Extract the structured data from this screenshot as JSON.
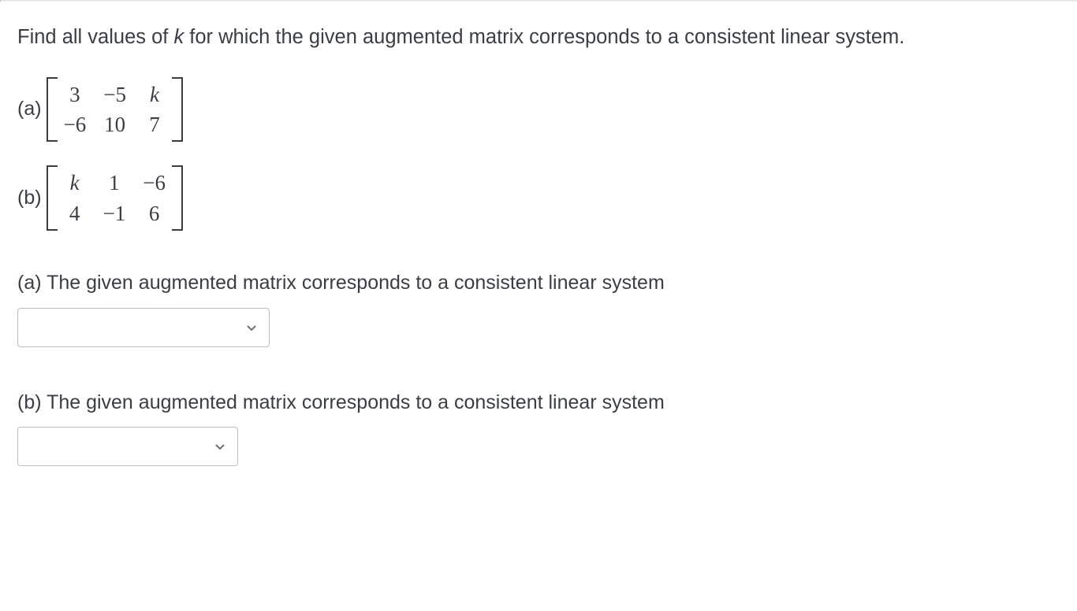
{
  "question": {
    "text_prefix": "Find all values of ",
    "variable": "k",
    "text_suffix": " for which the given augmented matrix corresponds to a consistent linear system."
  },
  "parts": {
    "a": {
      "label": "(a)",
      "matrix": {
        "r1c1": "3",
        "r1c2": "−5",
        "r1c3": "k",
        "r2c1": "−6",
        "r2c2": "10",
        "r2c3": "7"
      }
    },
    "b": {
      "label": "(b)",
      "matrix": {
        "r1c1": "k",
        "r1c2": "1",
        "r1c3": "−6",
        "r2c1": "4",
        "r2c2": "−1",
        "r2c3": "6"
      }
    }
  },
  "answers": {
    "a_prompt": "(a) The given augmented matrix corresponds to a consistent linear system",
    "b_prompt": "(b) The given augmented matrix corresponds to a consistent linear system"
  }
}
